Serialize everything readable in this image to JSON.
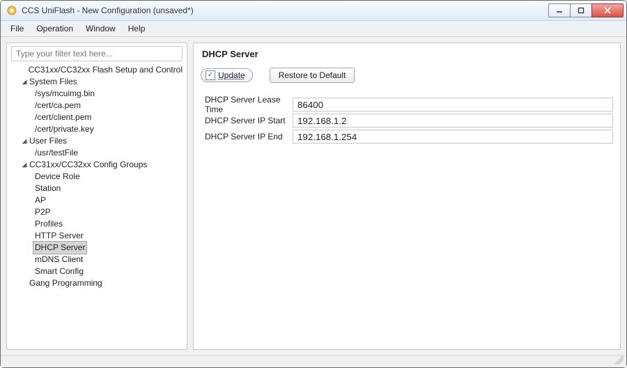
{
  "window": {
    "title": "CCS UniFlash - New Configuration (unsaved*)"
  },
  "menubar": {
    "file": "File",
    "operation": "Operation",
    "window": "Window",
    "help": "Help"
  },
  "sidebar": {
    "filter_placeholder": "Type your filter text here...",
    "items": [
      {
        "label": "CC31xx/CC32xx Flash Setup and Control",
        "level": 1,
        "expandable": false
      },
      {
        "label": "System Files",
        "level": 1,
        "expandable": true,
        "expanded": true
      },
      {
        "label": "/sys/mcuimg.bin",
        "level": 2
      },
      {
        "label": "/cert/ca.pem",
        "level": 2
      },
      {
        "label": "/cert/client.pem",
        "level": 2
      },
      {
        "label": "/cert/private.key",
        "level": 2
      },
      {
        "label": "User Files",
        "level": 1,
        "expandable": true,
        "expanded": true
      },
      {
        "label": "/usr/testFile",
        "level": 2
      },
      {
        "label": "CC31xx/CC32xx Config Groups",
        "level": 1,
        "expandable": true,
        "expanded": true
      },
      {
        "label": "Device Role",
        "level": 2
      },
      {
        "label": "Station",
        "level": 2
      },
      {
        "label": "AP",
        "level": 2
      },
      {
        "label": "P2P",
        "level": 2
      },
      {
        "label": "Profiles",
        "level": 2
      },
      {
        "label": "HTTP Server",
        "level": 2
      },
      {
        "label": "DHCP Server",
        "level": 2,
        "selected": true
      },
      {
        "label": "mDNS Client",
        "level": 2
      },
      {
        "label": "Smart Config",
        "level": 2
      },
      {
        "label": "Gang Programming",
        "level": 1,
        "expandable": false
      }
    ]
  },
  "main": {
    "heading": "DHCP Server",
    "update_label": "Update",
    "restore_label": "Restore to Default",
    "fields": [
      {
        "label": "DHCP Server Lease Time",
        "value": "86400"
      },
      {
        "label": "DHCP Server IP Start",
        "value": "192.168.1.2"
      },
      {
        "label": "DHCP Server IP End",
        "value": "192.168.1.254"
      }
    ]
  }
}
